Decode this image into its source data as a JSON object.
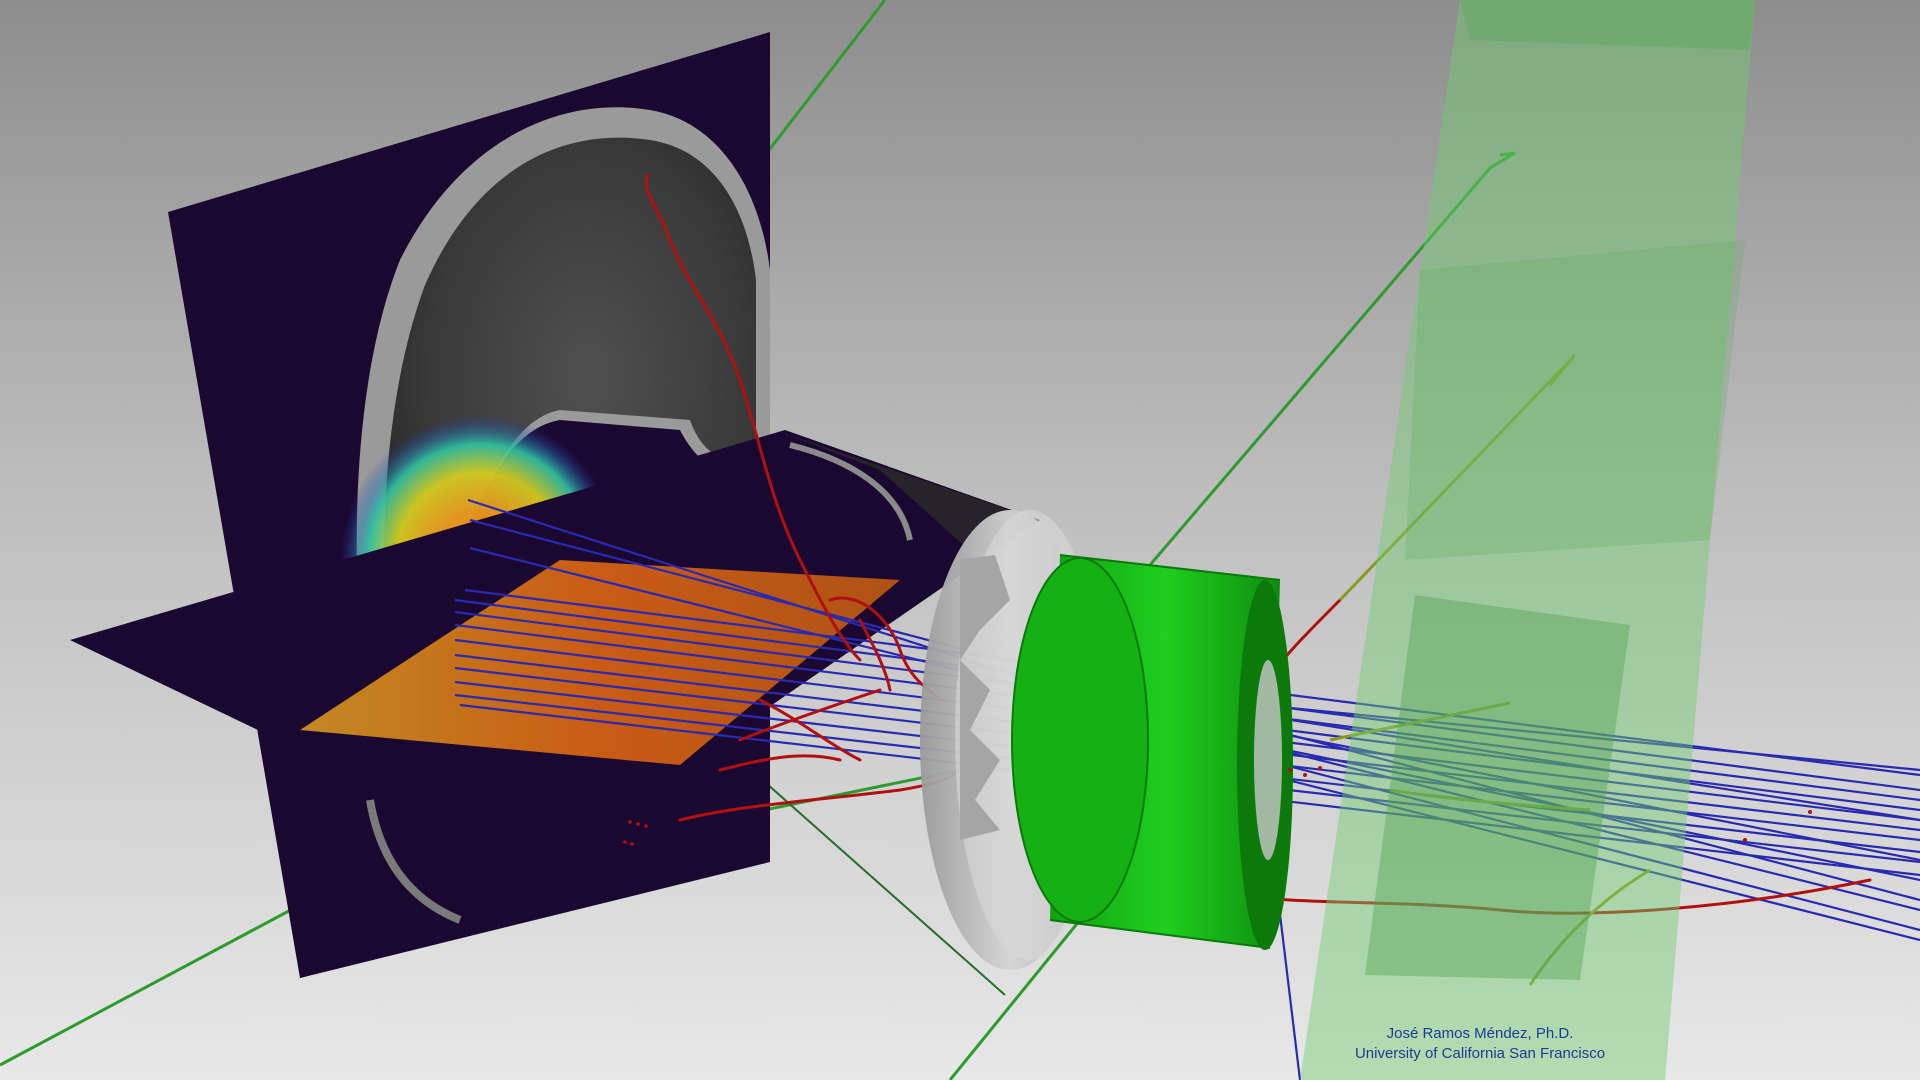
{
  "credit": {
    "name": "José Ramos Méndez, Ph.D.",
    "affiliation": "University of California San Francisco"
  },
  "colors": {
    "background_top": "#8f8f8f",
    "background_bottom": "#e6e6e6",
    "ct_plane_border": "#1b0830",
    "primary_beam": "#2222aa",
    "secondary_track": "#b01010",
    "photon_track": "#2e9b2e",
    "aperture": "#1fbf1f",
    "compensator": "#c8c8c8",
    "detector_volume": "#7fd27f",
    "credit_text": "#1f3a93"
  }
}
